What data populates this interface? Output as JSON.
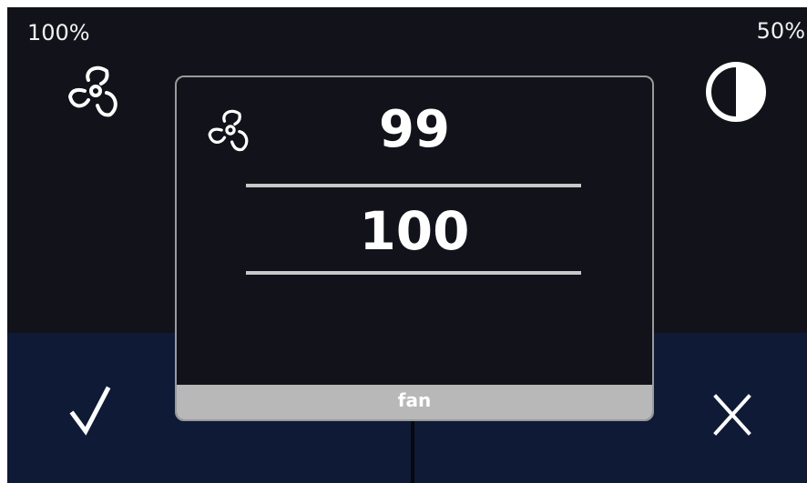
{
  "status": {
    "fan_speed": "100%",
    "light_level": "50%"
  },
  "icons": {
    "fan": "fan-icon",
    "light": "half-circle-icon",
    "confirm": "checkmark-icon",
    "cancel": "close-icon"
  },
  "dialog": {
    "current_value": "99",
    "target_value": "100",
    "label": "fan"
  },
  "colors": {
    "background": "#12121a",
    "bottom_panel": "#0e1a36",
    "divider": "#c8c8c8",
    "footer": "#b8b8b8",
    "text": "#ffffff"
  }
}
